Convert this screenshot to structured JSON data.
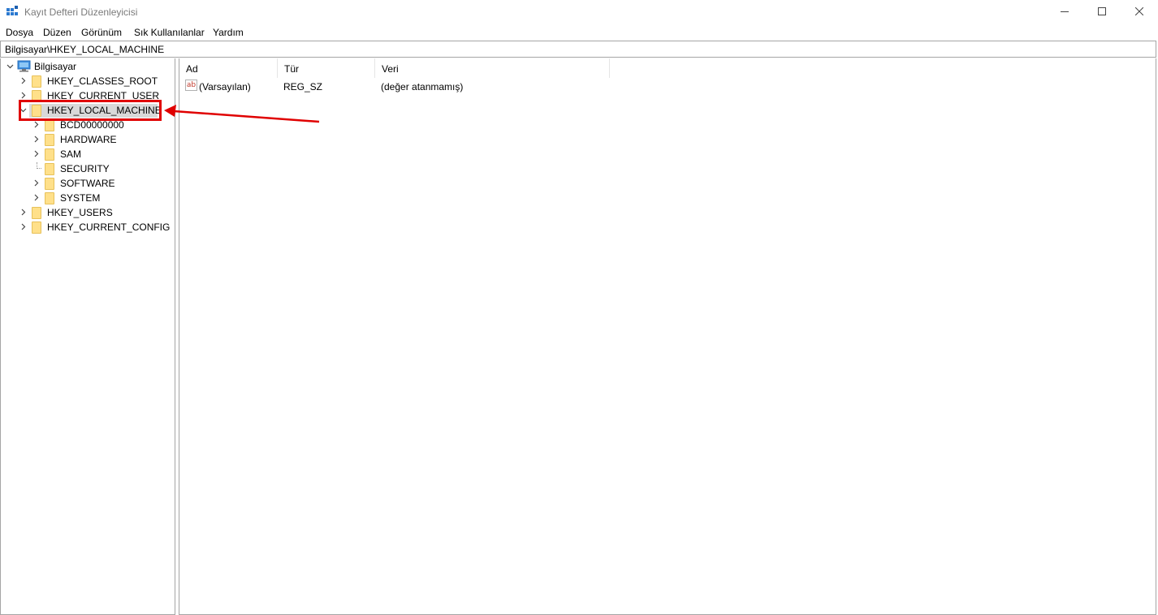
{
  "window": {
    "title": "Kayıt Defteri Düzenleyicisi",
    "icons": {
      "app": "registry-editor-icon",
      "minimize": "minimize-icon",
      "maximize": "maximize-icon",
      "close": "close-icon"
    }
  },
  "menu": {
    "items": [
      "Dosya",
      "Düzen",
      "Görünüm",
      "Sık Kullanılanlar",
      "Yardım"
    ]
  },
  "address": {
    "path": "Bilgisayar\\HKEY_LOCAL_MACHINE"
  },
  "tree": {
    "root": "Bilgisayar",
    "hives": [
      {
        "label": "HKEY_CLASSES_ROOT",
        "expanded": false
      },
      {
        "label": "HKEY_CURRENT_USER",
        "expanded": false
      },
      {
        "label": "HKEY_LOCAL_MACHINE",
        "expanded": true,
        "selected": true
      },
      {
        "label": "HKEY_USERS",
        "expanded": false
      },
      {
        "label": "HKEY_CURRENT_CONFIG",
        "expanded": false
      }
    ],
    "hklm_children": [
      "BCD00000000",
      "HARDWARE",
      "SAM",
      "SECURITY",
      "SOFTWARE",
      "SYSTEM"
    ]
  },
  "list": {
    "columns": [
      "Ad",
      "Tür",
      "Veri"
    ],
    "rows": [
      {
        "name": "(Varsayılan)",
        "type": "REG_SZ",
        "data": "(değer atanmamış)",
        "icon": "ab"
      }
    ]
  },
  "annotation": {
    "highlight_color": "#e00000"
  }
}
